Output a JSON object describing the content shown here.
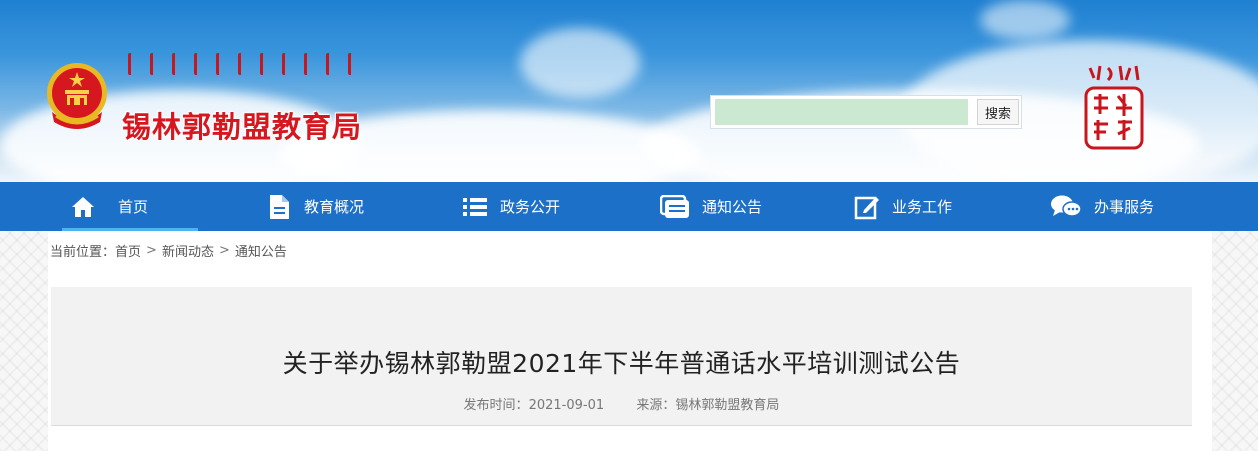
{
  "header": {
    "site_title": "锡林郭勒盟教育局",
    "search": {
      "placeholder": "",
      "value": "",
      "button_label": "搜索"
    }
  },
  "nav": {
    "items": [
      {
        "label": "首页",
        "icon": "home-icon",
        "active": true
      },
      {
        "label": "教育概况",
        "icon": "document-icon",
        "active": false
      },
      {
        "label": "政务公开",
        "icon": "list-icon",
        "active": false
      },
      {
        "label": "通知公告",
        "icon": "notice-icon",
        "active": false
      },
      {
        "label": "业务工作",
        "icon": "edit-icon",
        "active": false
      },
      {
        "label": "办事服务",
        "icon": "chat-icon",
        "active": false
      }
    ]
  },
  "breadcrumb": {
    "prefix": "当前位置：",
    "items": [
      "首页",
      "新闻动态",
      "通知公告"
    ],
    "separator": ">"
  },
  "article": {
    "title": "关于举办锡林郭勒盟2021年下半年普通话水平培训测试公告",
    "publish_label": "发布时间：",
    "publish_date": "2021-09-01",
    "source_label": "来源：",
    "source": "锡林郭勒盟教育局"
  },
  "colors": {
    "nav_bg": "#1d70c8",
    "title_red": "#d6171f",
    "search_bg": "#cbe8d0",
    "article_bg": "#f2f2f2"
  }
}
